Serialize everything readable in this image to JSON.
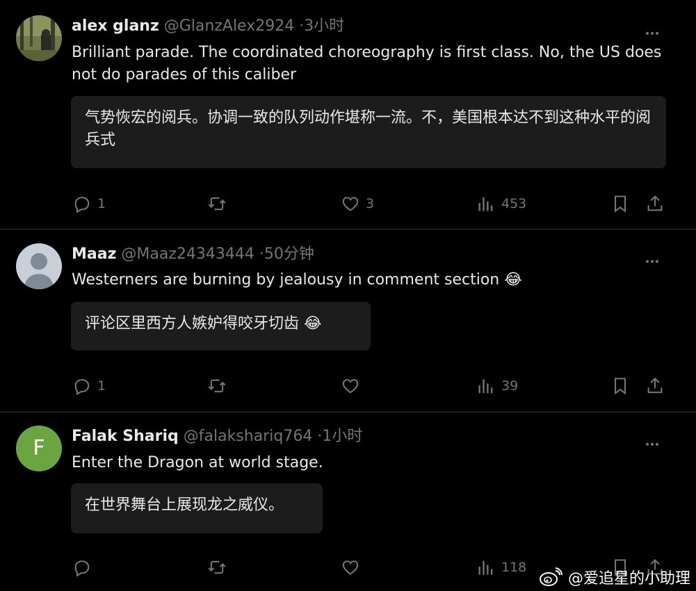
{
  "colors": {
    "background": "#000000",
    "text": "#e7e9ea",
    "muted": "#71767b",
    "translation_bg": "#1c1c1c",
    "avatar_f": "#6ba540"
  },
  "posts": [
    {
      "display_name": "alex glanz",
      "handle": "@GlanzAlex2924",
      "separator": "·",
      "time": "3小时",
      "text": "Brilliant parade.  The coordinated choreography is first class.  No, the US does not do parades of this caliber",
      "translation": "气势恢宏的阅兵。协调一致的队列动作堪称一流。不，美国根本达不到这种水平的阅兵式",
      "avatar": "photo-avatar",
      "replies": "1",
      "reposts": "",
      "likes": "3",
      "views": "453"
    },
    {
      "display_name": "Maaz",
      "handle": "@Maaz24343444",
      "separator": "·",
      "time": "50分钟",
      "text": "Westerners are burning by jealousy in comment section 😂",
      "translation": "评论区里西方人嫉妒得咬牙切齿 😂",
      "avatar": "default-avatar",
      "replies": "1",
      "reposts": "",
      "likes": "",
      "views": "39"
    },
    {
      "display_name": "Falak Shariq",
      "handle": "@falakshariq764",
      "separator": "·",
      "time": "1小时",
      "text": "Enter the Dragon at world stage.",
      "translation": "在世界舞台上展现龙之威仪。",
      "avatar": "letter-avatar",
      "avatar_letter": "F",
      "replies": "",
      "reposts": "",
      "likes": "",
      "views": "118"
    }
  ],
  "watermark": {
    "text": "@爱追星的小助理",
    "icon": "weibo-logo-icon"
  }
}
